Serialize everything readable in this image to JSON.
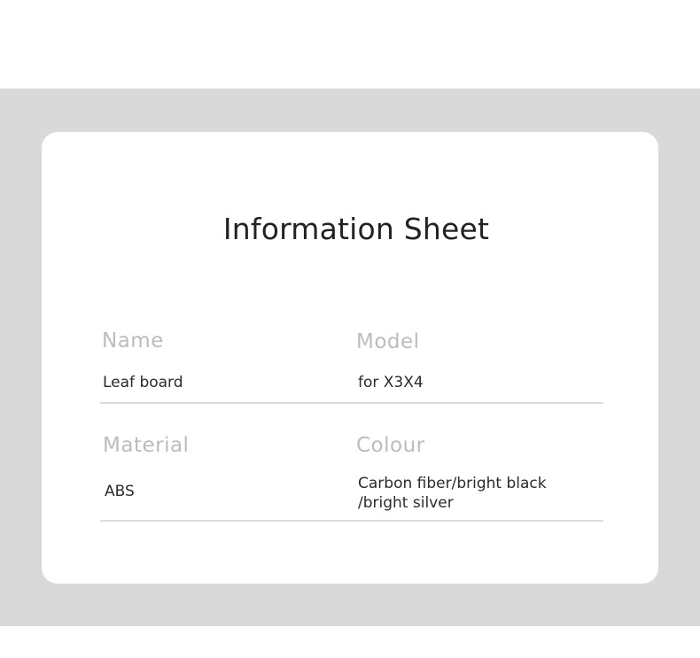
{
  "title": "Information Sheet",
  "rows": [
    {
      "left": {
        "label": "Name",
        "value": "Leaf board"
      },
      "right": {
        "label": "Model",
        "value": "for X3X4"
      }
    },
    {
      "left": {
        "label": "Material",
        "value": "ABS"
      },
      "right": {
        "label": "Colour",
        "value_line1": "Carbon fiber/bright black",
        "value_line2": "/bright silver"
      }
    }
  ]
}
